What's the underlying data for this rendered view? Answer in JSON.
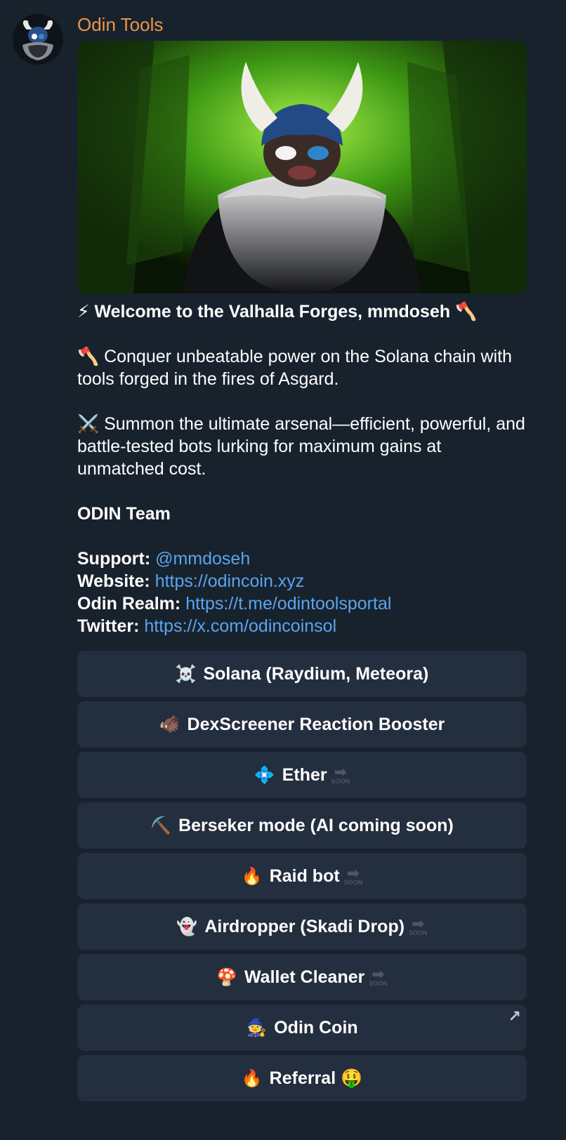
{
  "sender": {
    "name": "Odin Tools"
  },
  "message": {
    "title": "⚡ Welcome to the Valhalla Forges, mmdoseh 🪓",
    "para1": "🪓 Conquer unbeatable power on the Solana chain with tools forged in the fires of Asgard.",
    "para2": "⚔️ Summon the ultimate arsenal—efficient, powerful, and battle-tested bots lurking for maximum gains at unmatched cost.",
    "signature": "ODIN Team",
    "links": [
      {
        "label": "Support:",
        "value": "@mmdoseh"
      },
      {
        "label": "Website:",
        "value": "https://odincoin.xyz"
      },
      {
        "label": "Odin Realm:",
        "value": "https://t.me/odintoolsportal"
      },
      {
        "label": "Twitter:",
        "value": "https://x.com/odincoinsol"
      }
    ]
  },
  "buttons": [
    {
      "emoji": "☠️",
      "label": "Solana (Raydium, Meteora)",
      "soon": ""
    },
    {
      "emoji": "🐗",
      "label": "DexScreener Reaction Booster",
      "soon": ""
    },
    {
      "emoji": "💠",
      "label": "Ether",
      "soon": "SOON"
    },
    {
      "emoji": "⛏️",
      "label": "Berseker mode (AI coming soon)",
      "soon": ""
    },
    {
      "emoji": "🔥",
      "label": "Raid bot",
      "soon": "SOON"
    },
    {
      "emoji": "👻",
      "label": "Airdropper (Skadi Drop)",
      "soon": "SOON"
    },
    {
      "emoji": "🍄",
      "label": "Wallet Cleaner",
      "soon": "SOON"
    },
    {
      "emoji": "🧙",
      "label": "Odin Coin",
      "soon": "",
      "corner": "↗"
    },
    {
      "emoji": "🔥",
      "label": "Referral 🤑",
      "soon": ""
    }
  ],
  "colors": {
    "background": "#18222d",
    "sender_name": "#e8964b",
    "link": "#5aa5ee",
    "button_bg": "#232e3e"
  }
}
